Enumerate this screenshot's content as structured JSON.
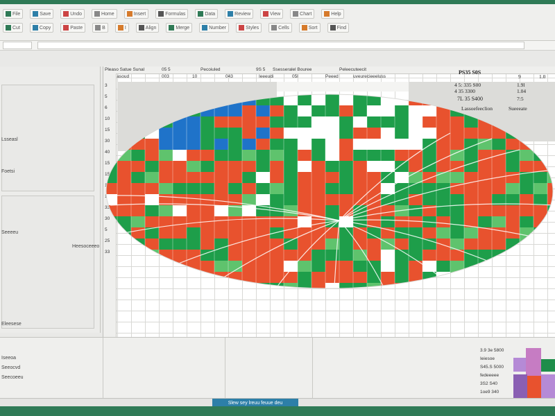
{
  "window": {
    "accent_color": "#2f7a56",
    "tab_color": "#2d7fa8"
  },
  "ribbon": {
    "row1": [
      {
        "icon": "file-icon",
        "label": "File"
      },
      {
        "icon": "save-icon",
        "label": "Save"
      },
      {
        "icon": "undo-icon",
        "label": "Undo"
      },
      {
        "icon": "home-icon",
        "label": "Home"
      },
      {
        "icon": "insert-icon",
        "label": "Insert"
      },
      {
        "icon": "formula-icon",
        "label": "Formulas"
      },
      {
        "icon": "data-icon",
        "label": "Data"
      },
      {
        "icon": "review-icon",
        "label": "Review"
      },
      {
        "icon": "view-icon",
        "label": "View"
      },
      {
        "icon": "chart-icon",
        "label": "Chart"
      },
      {
        "icon": "help-icon",
        "label": "Help"
      }
    ],
    "row2": [
      {
        "icon": "cut-icon",
        "label": "Cut"
      },
      {
        "icon": "copy-icon",
        "label": "Copy"
      },
      {
        "icon": "paste-icon",
        "label": "Paste"
      },
      {
        "icon": "bold-icon",
        "label": "B"
      },
      {
        "icon": "italic-icon",
        "label": "I"
      },
      {
        "icon": "align-icon",
        "label": "Align"
      },
      {
        "icon": "merge-icon",
        "label": "Merge"
      },
      {
        "icon": "number-icon",
        "label": "Number"
      },
      {
        "icon": "style-icon",
        "label": "Styles"
      },
      {
        "icon": "cells-icon",
        "label": "Cells"
      },
      {
        "icon": "sort-icon",
        "label": "Sort"
      },
      {
        "icon": "find-icon",
        "label": "Find"
      }
    ]
  },
  "sheet": {
    "col_headers": [
      "Pleaso Satue Sunal",
      "05 5",
      "Pecoiuled",
      "9S 5",
      "Ssesseralel Bouree",
      "Peleecuteecit"
    ],
    "row2_values": [
      "Pleasoud",
      "003",
      "10",
      "043",
      "Ieeeudi",
      "05l",
      "Peeed",
      "uveurecieeeluss"
    ],
    "row_labels": [
      "3",
      "5",
      "6",
      "10",
      "15",
      "30",
      "40",
      "15",
      "15",
      "15",
      "15",
      "33",
      "30",
      "5",
      "25",
      "33"
    ],
    "top_right": {
      "title": "PS35 S0S",
      "rows": [
        {
          "a": "4 5: 335 S00",
          "b": "1.9l"
        },
        {
          "a": "4 35 3300",
          "b": "1.04"
        },
        {
          "a": "7L 35 S400",
          "b": "7:5"
        }
      ],
      "label1": "Lassoefeeclion",
      "label2": "Sueeeate",
      "header_right": "9",
      "header_far": "1.0"
    }
  },
  "left_pane": {
    "labels": [
      "Lsseasl",
      "Foetsi",
      "Seeeeu",
      "Heesoceeeo",
      "Eleesese"
    ]
  },
  "bottom_pane": {
    "labels": [
      "Iseeoa",
      "Seeocvd",
      "Seecoeeu"
    ],
    "mini_rows": [
      "3.9 3e 5800",
      "Ieiesoe",
      "S45.S 5000",
      "fedeeeee",
      "3S2 S40",
      "1oe9 340"
    ]
  },
  "tabbar": {
    "active_tab": "Slew sey lreuu feuue deu"
  },
  "mini_chart": {
    "colors": [
      "#8a5fb3",
      "#c67cc3",
      "#1e8d4a",
      "#e8522e",
      "#b58ad6"
    ]
  }
}
